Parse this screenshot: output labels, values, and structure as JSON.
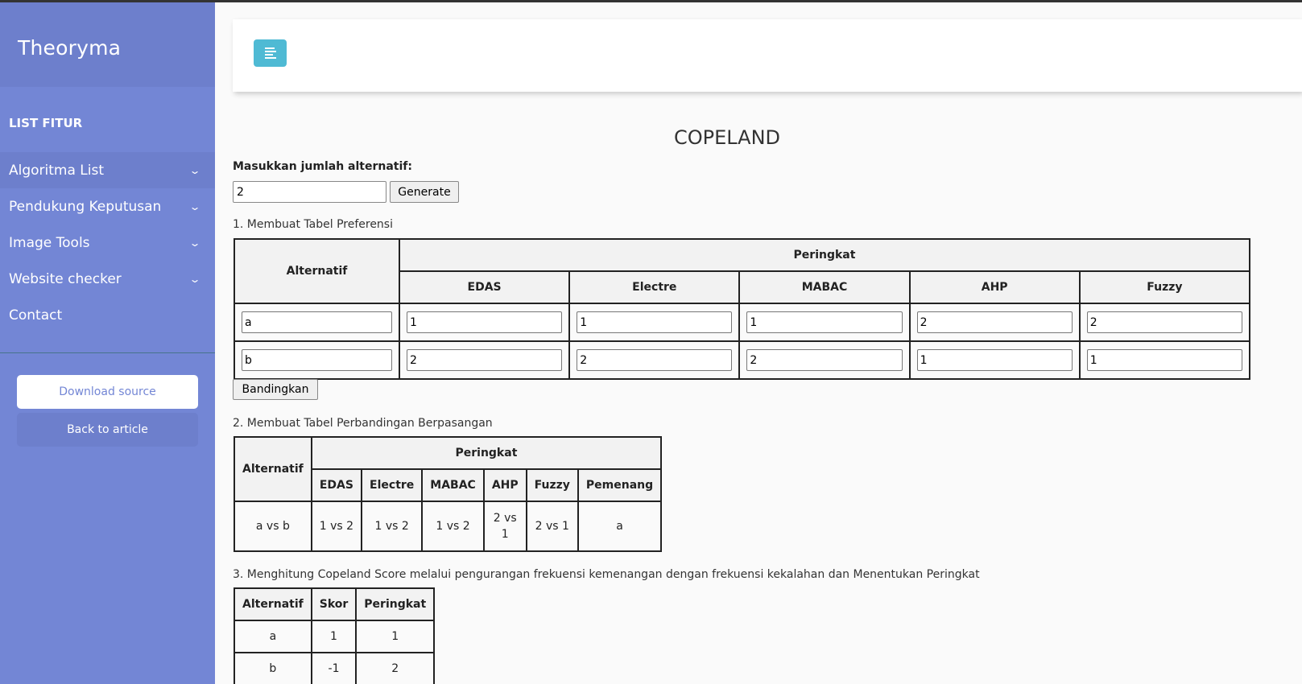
{
  "sidebar": {
    "brand": "Theoryma",
    "list_title": "LIST FITUR",
    "items": [
      {
        "label": "Algoritma List"
      },
      {
        "label": "Pendukung Keputusan"
      },
      {
        "label": "Image Tools"
      },
      {
        "label": "Website checker"
      },
      {
        "label": "Contact"
      }
    ],
    "download_label": "Download source",
    "back_label": "Back to article"
  },
  "main": {
    "title": "COPELAND",
    "input_label": "Masukkan jumlah alternatif:",
    "input_value": "2",
    "generate_label": "Generate",
    "step1": "1. Membuat Tabel Preferensi",
    "step2": "2. Membuat Tabel Perbandingan Berpasangan",
    "step3": "3. Menghitung Copeland Score melalui pengurangan frekuensi kemenangan dengan frekuensi kekalahan dan Menentukan Peringkat",
    "compare_label": "Bandingkan"
  },
  "pref_table": {
    "h_alt": "Alternatif",
    "h_rank": "Peringkat",
    "methods": [
      "EDAS",
      "Electre",
      "MABAC",
      "AHP",
      "Fuzzy"
    ],
    "rows": [
      {
        "alt": "a",
        "vals": [
          "1",
          "1",
          "1",
          "2",
          "2"
        ]
      },
      {
        "alt": "b",
        "vals": [
          "2",
          "2",
          "2",
          "1",
          "1"
        ]
      }
    ]
  },
  "pair_table": {
    "h_alt": "Alternatif",
    "h_rank": "Peringkat",
    "cols": [
      "EDAS",
      "Electre",
      "MABAC",
      "AHP",
      "Fuzzy",
      "Pemenang"
    ],
    "row": [
      "a vs b",
      "1 vs 2",
      "1 vs 2",
      "1 vs 2",
      "2 vs 1",
      "2 vs 1",
      "a"
    ]
  },
  "score_table": {
    "headers": [
      "Alternatif",
      "Skor",
      "Peringkat"
    ],
    "rows": [
      [
        "a",
        "1",
        "1"
      ],
      [
        "b",
        "-1",
        "2"
      ]
    ]
  }
}
